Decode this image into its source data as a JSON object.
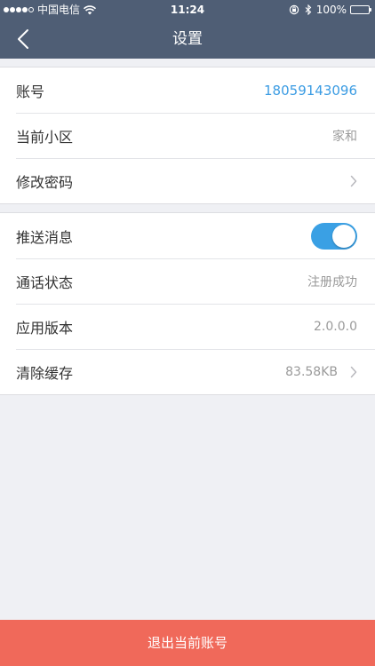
{
  "status_bar": {
    "carrier": "中国电信",
    "time": "11:24",
    "battery": "100%",
    "signal_bars_filled": 4,
    "signal_bars_total": 5
  },
  "nav": {
    "title": "设置",
    "back_icon": "chevron-left-icon"
  },
  "group1": {
    "account": {
      "label": "账号",
      "value": "18059143096"
    },
    "community": {
      "label": "当前小区",
      "value": "家和"
    },
    "password": {
      "label": "修改密码"
    }
  },
  "group2": {
    "push": {
      "label": "推送消息",
      "enabled": true
    },
    "call_status": {
      "label": "通话状态",
      "value": "注册成功"
    },
    "version": {
      "label": "应用版本",
      "value": "2.0.0.0"
    },
    "cache": {
      "label": "清除缓存",
      "value": "83.58KB"
    }
  },
  "logout": {
    "label": "退出当前账号"
  },
  "colors": {
    "nav_bg": "#4f5e75",
    "link": "#3b9ce3",
    "toggle_on": "#3aa0e4",
    "logout_bg": "#f0695a",
    "page_bg": "#eff0f4"
  }
}
